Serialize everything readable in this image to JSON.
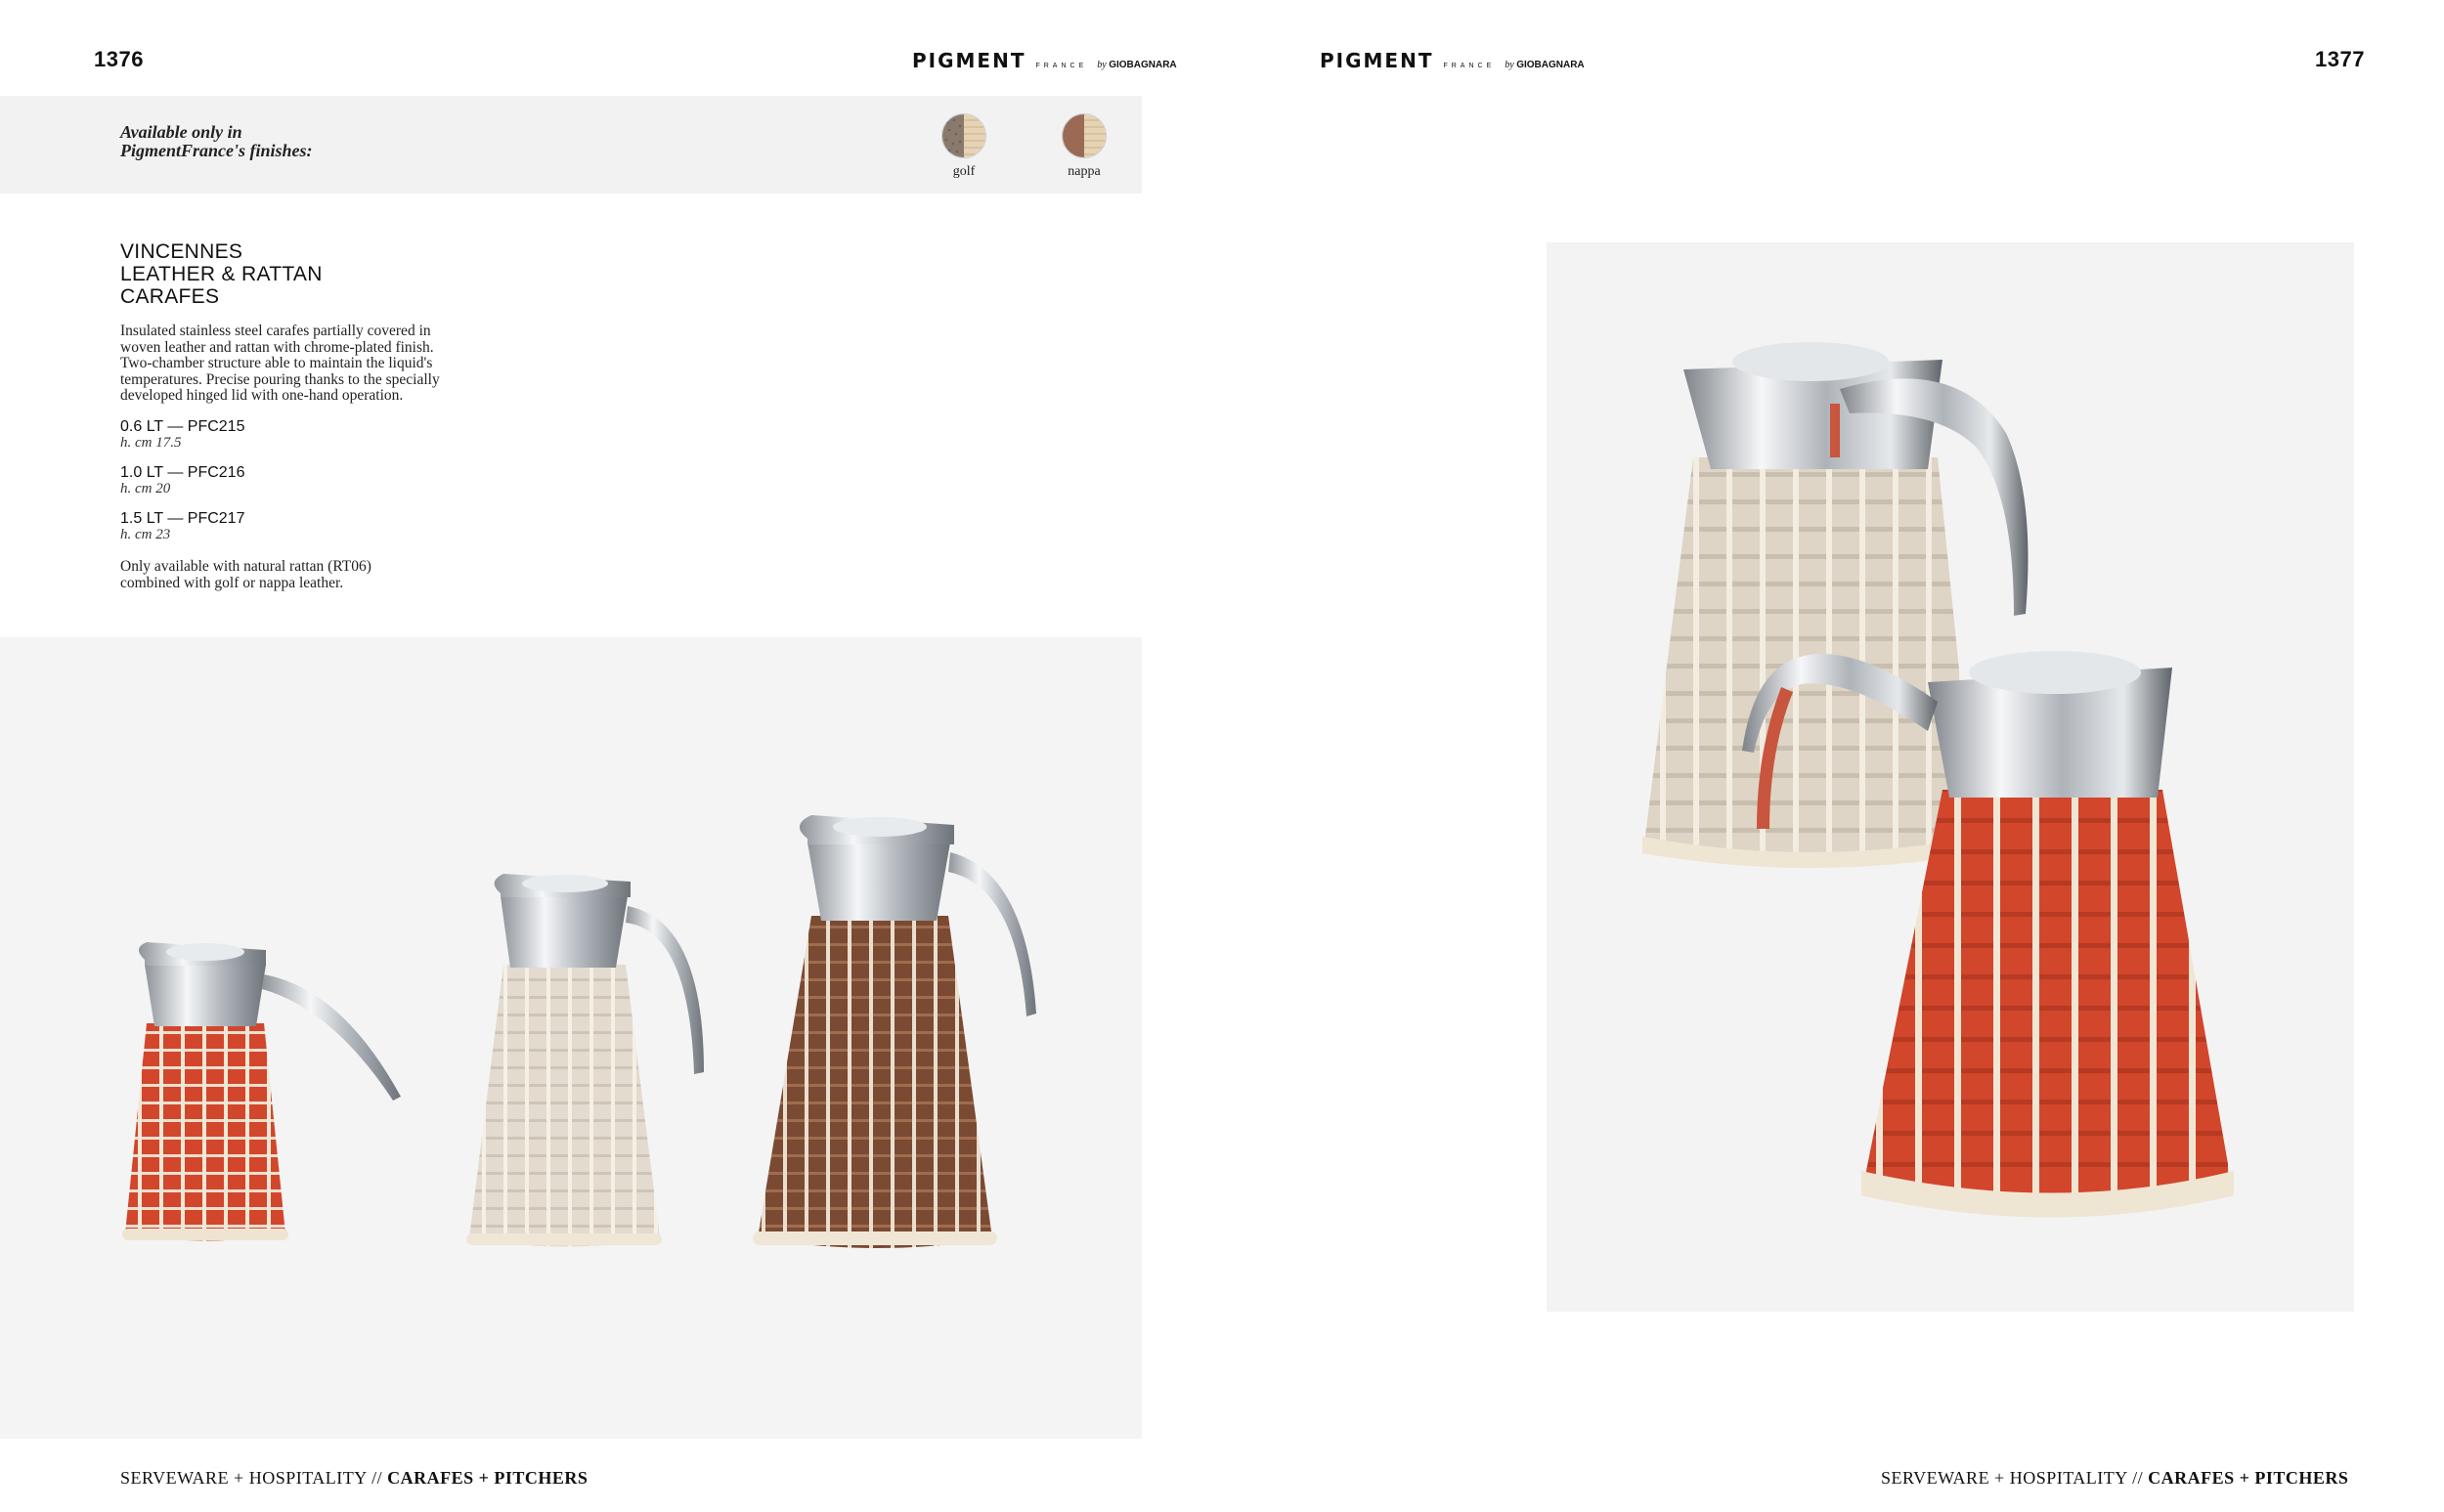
{
  "left_page": {
    "page_number": "1376",
    "brand": {
      "name": "PIGMENT",
      "sub": "FRANCE",
      "by": "by",
      "maker": "GIOBAGNARA"
    },
    "finishes": {
      "title_line1": "Available only in",
      "title_line2": "PigmentFrance's finishes:",
      "swatches": [
        {
          "label": "golf"
        },
        {
          "label": "nappa"
        }
      ]
    },
    "product": {
      "title_lines": [
        "VINCENNES",
        "LEATHER & RATTAN",
        "CARAFES"
      ],
      "description_lines": [
        "Insulated stainless steel carafes partially covered in",
        "woven leather and rattan with chrome-plated finish.",
        "Two-chamber structure able to maintain the liquid's",
        "temperatures. Precise pouring thanks to the specially",
        "developed hinged lid with one-hand operation."
      ],
      "variants": [
        {
          "code": "0.6 LT — PFC215",
          "height": "h. cm 17.5"
        },
        {
          "code": "1.0 LT — PFC216",
          "height": "h. cm 20"
        },
        {
          "code": "1.5 LT — PFC217",
          "height": "h. cm 23"
        }
      ],
      "note_lines": [
        "Only available with natural rattan (RT06)",
        "combined with golf or nappa leather."
      ]
    },
    "footer": {
      "section": "SERVEWARE + HOSPITALITY //",
      "category": "CARAFES + PITCHERS"
    }
  },
  "right_page": {
    "page_number": "1377",
    "brand": {
      "name": "PIGMENT",
      "sub": "FRANCE",
      "by": "by",
      "maker": "GIOBAGNARA"
    },
    "footer": {
      "section": "SERVEWARE + HOSPITALITY //",
      "category": "CARAFES + PITCHERS"
    }
  },
  "colors": {
    "leather_red": "#d2462c",
    "rattan_cream": "#e9dfcf",
    "leather_brown": "#7a4a33",
    "chrome": "#c9cdd2"
  }
}
